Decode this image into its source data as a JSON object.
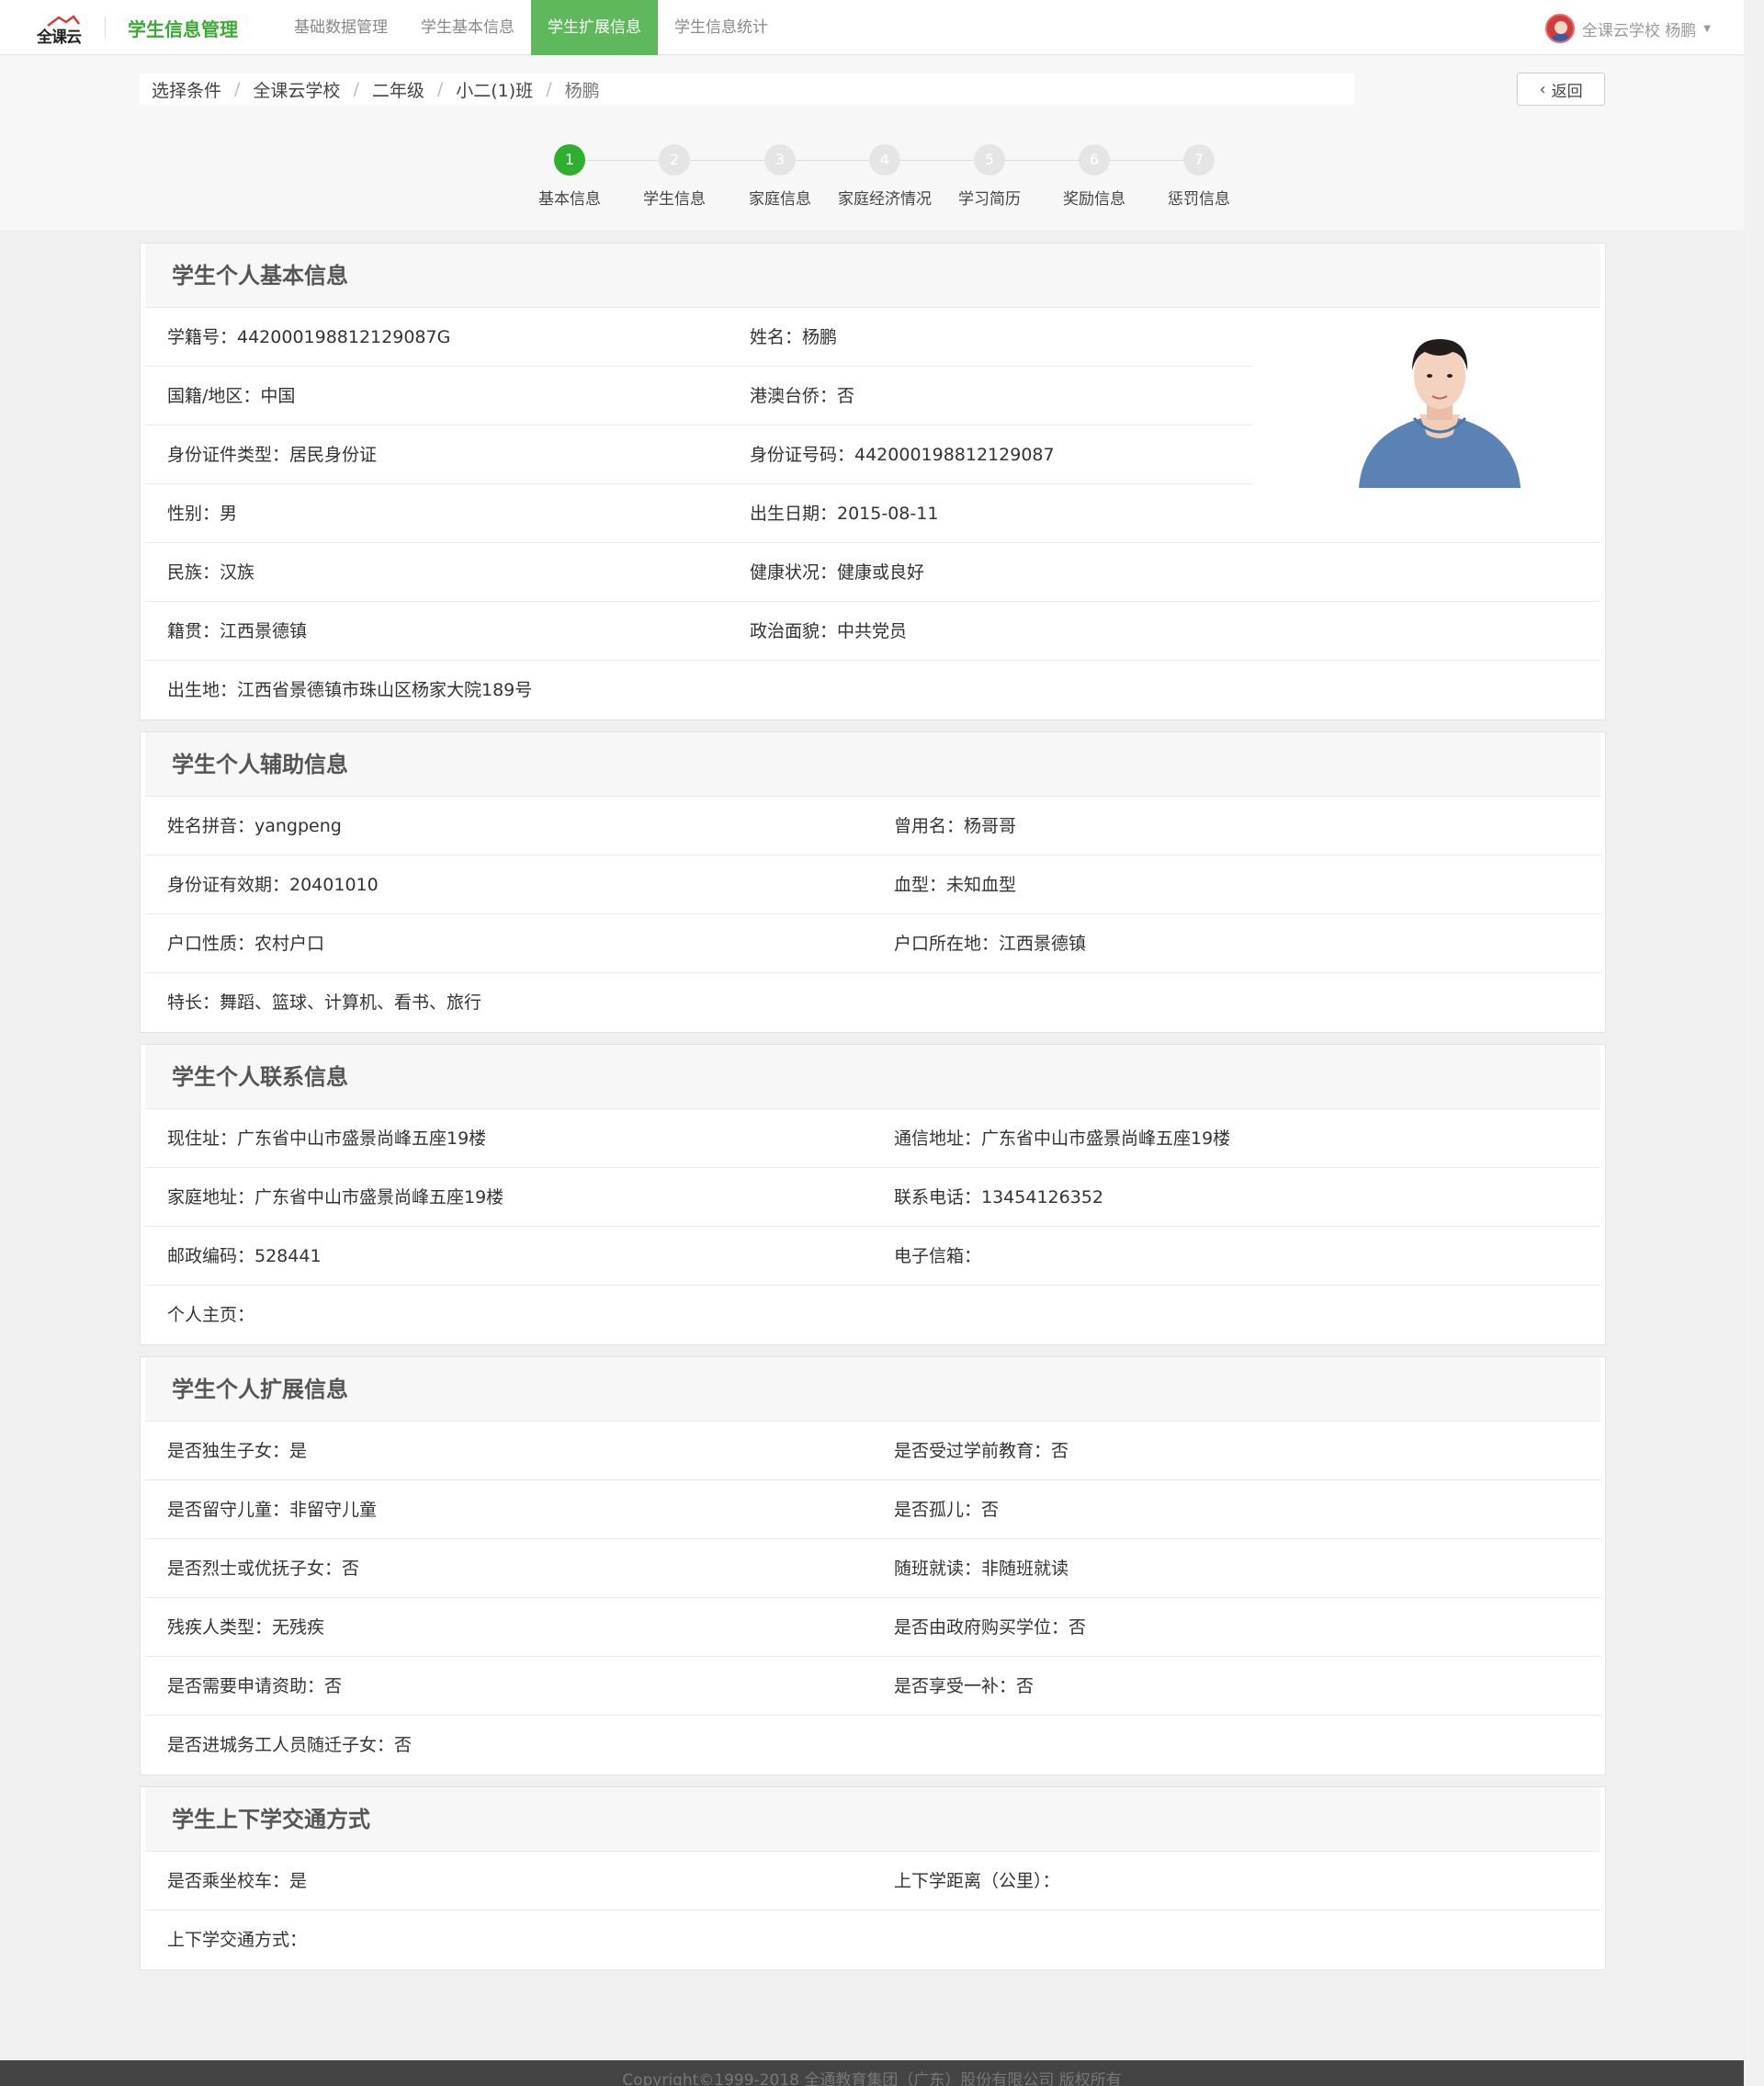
{
  "topnav": {
    "logo_text": "全课云",
    "app_title": "学生信息管理",
    "items": [
      {
        "label": "基础数据管理"
      },
      {
        "label": "学生基本信息"
      },
      {
        "label": "学生扩展信息"
      },
      {
        "label": "学生信息统计"
      }
    ],
    "active_index": 2,
    "user": "全课云学校 杨鹏"
  },
  "breadcrumb": [
    "选择条件",
    "全课云学校",
    "二年级",
    "小二(1)班",
    "杨鹏"
  ],
  "back_label": "返回",
  "steps": [
    {
      "num": "1",
      "label": "基本信息"
    },
    {
      "num": "2",
      "label": "学生信息"
    },
    {
      "num": "3",
      "label": "家庭信息"
    },
    {
      "num": "4",
      "label": "家庭经济情况"
    },
    {
      "num": "5",
      "label": "学习简历"
    },
    {
      "num": "6",
      "label": "奖励信息"
    },
    {
      "num": "7",
      "label": "惩罚信息"
    }
  ],
  "basic": {
    "title": "学生个人基本信息",
    "rows": [
      [
        "学籍号：442000198812129087G",
        "姓名：杨鹏"
      ],
      [
        "国籍/地区：中国",
        "港澳台侨：否"
      ],
      [
        "身份证件类型：居民身份证",
        "身份证号码：442000198812129087"
      ],
      [
        "性别：男",
        "出生日期：2015-08-11"
      ],
      [
        "民族：汉族",
        "健康状况：健康或良好"
      ],
      [
        "籍贯：江西景德镇",
        "政治面貌：中共党员"
      ],
      [
        "出生地：江西省景德镇市珠山区杨家大院189号",
        ""
      ]
    ]
  },
  "aux": {
    "title": "学生个人辅助信息",
    "rows": [
      [
        "姓名拼音：yangpeng",
        "曾用名：杨哥哥"
      ],
      [
        "身份证有效期：20401010",
        "血型：未知血型"
      ],
      [
        "户口性质：农村户口",
        "户口所在地：江西景德镇"
      ],
      [
        "特长：舞蹈、篮球、计算机、看书、旅行",
        ""
      ]
    ]
  },
  "contact": {
    "title": "学生个人联系信息",
    "rows": [
      [
        "现住址：广东省中山市盛景尚峰五座19楼",
        "通信地址：广东省中山市盛景尚峰五座19楼"
      ],
      [
        "家庭地址：广东省中山市盛景尚峰五座19楼",
        "联系电话：13454126352"
      ],
      [
        "邮政编码：528441",
        "电子信箱："
      ],
      [
        "个人主页：",
        ""
      ]
    ]
  },
  "ext": {
    "title": "学生个人扩展信息",
    "rows": [
      [
        "是否独生子女：是",
        "是否受过学前教育：否"
      ],
      [
        "是否留守儿童：非留守儿童",
        "是否孤儿：否"
      ],
      [
        "是否烈士或优抚子女：否",
        "随班就读：非随班就读"
      ],
      [
        "残疾人类型：无残疾",
        "是否由政府购买学位：否"
      ],
      [
        "是否需要申请资助：否",
        "是否享受一补：否"
      ],
      [
        "是否进城务工人员随迁子女：否",
        ""
      ]
    ]
  },
  "transport": {
    "title": "学生上下学交通方式",
    "rows": [
      [
        "是否乘坐校车：是",
        "上下学距离（公里）："
      ],
      [
        "上下学交通方式：",
        ""
      ]
    ]
  },
  "footer": "Copyright©1999-2018 全通教育集团（广东）股份有限公司 版权所有"
}
